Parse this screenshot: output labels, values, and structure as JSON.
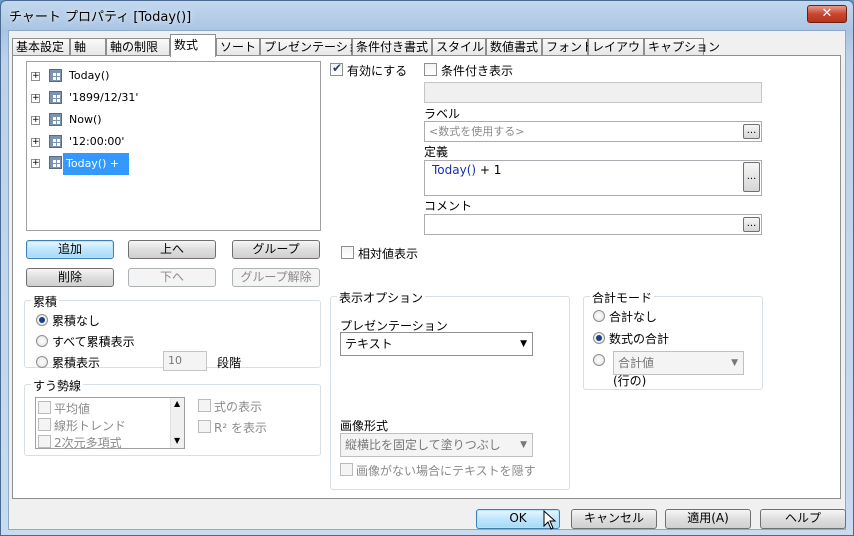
{
  "window": {
    "title": "チャート プロパティ [Today()]",
    "close_glyph": "✕"
  },
  "tabs": [
    "基本設定",
    "軸",
    "軸の制限",
    "数式",
    "ソート",
    "プレゼンテーション",
    "条件付き書式",
    "スタイル",
    "数値書式",
    "フォント",
    "レイアウト",
    "キャプション"
  ],
  "active_tab": "数式",
  "expressions": [
    "Today()",
    "'1899/12/31'",
    "Now()",
    "'12:00:00'",
    "Today() + 1"
  ],
  "selected_expression": "Today() + 1",
  "buttons": {
    "add": "追加",
    "up": "上へ",
    "group": "グループ",
    "delete": "削除",
    "down": "下へ",
    "ungroup": "グループ解除"
  },
  "enable": {
    "label": "有効にする",
    "checked": true
  },
  "conditional": {
    "label": "条件付き表示",
    "checked": false
  },
  "label_section": {
    "title": "ラベル",
    "placeholder": "<数式を使用する>"
  },
  "definition": {
    "title": "定義",
    "func": "Today()",
    "rest": " + 1"
  },
  "comment": {
    "title": "コメント"
  },
  "ellipsis": "...",
  "relative": {
    "label": "相対値表示",
    "checked": false
  },
  "accumulation": {
    "title": "累積",
    "options": [
      "累積なし",
      "すべて累積表示",
      "累積表示"
    ],
    "selected": 0,
    "steps_value": "10",
    "steps_label": "段階"
  },
  "trendlines": {
    "title": "すう勢線",
    "items": [
      "平均値",
      "線形トレンド",
      "2次元多項式"
    ],
    "show_formula": "式の表示",
    "show_r2": "R² を表示"
  },
  "display_options": {
    "title": "表示オプション",
    "presentation_label": "プレゼンテーション",
    "presentation_value": "テキスト",
    "image_format_label": "画像形式",
    "image_format_value": "縦横比を固定して塗りつぶし",
    "hide_text_label": "画像がない場合にテキストを隠す"
  },
  "total_mode": {
    "title": "合計モード",
    "options": [
      "合計なし",
      "数式の合計"
    ],
    "selected": 1,
    "combo_value": "合計値",
    "rows_label": "(行の)"
  },
  "dialog_buttons": {
    "ok": "OK",
    "cancel": "キャンセル",
    "apply": "適用(A)",
    "help": "ヘルプ"
  },
  "colors": {
    "selection": "#3399ff",
    "function_text": "#1a2fb0"
  }
}
